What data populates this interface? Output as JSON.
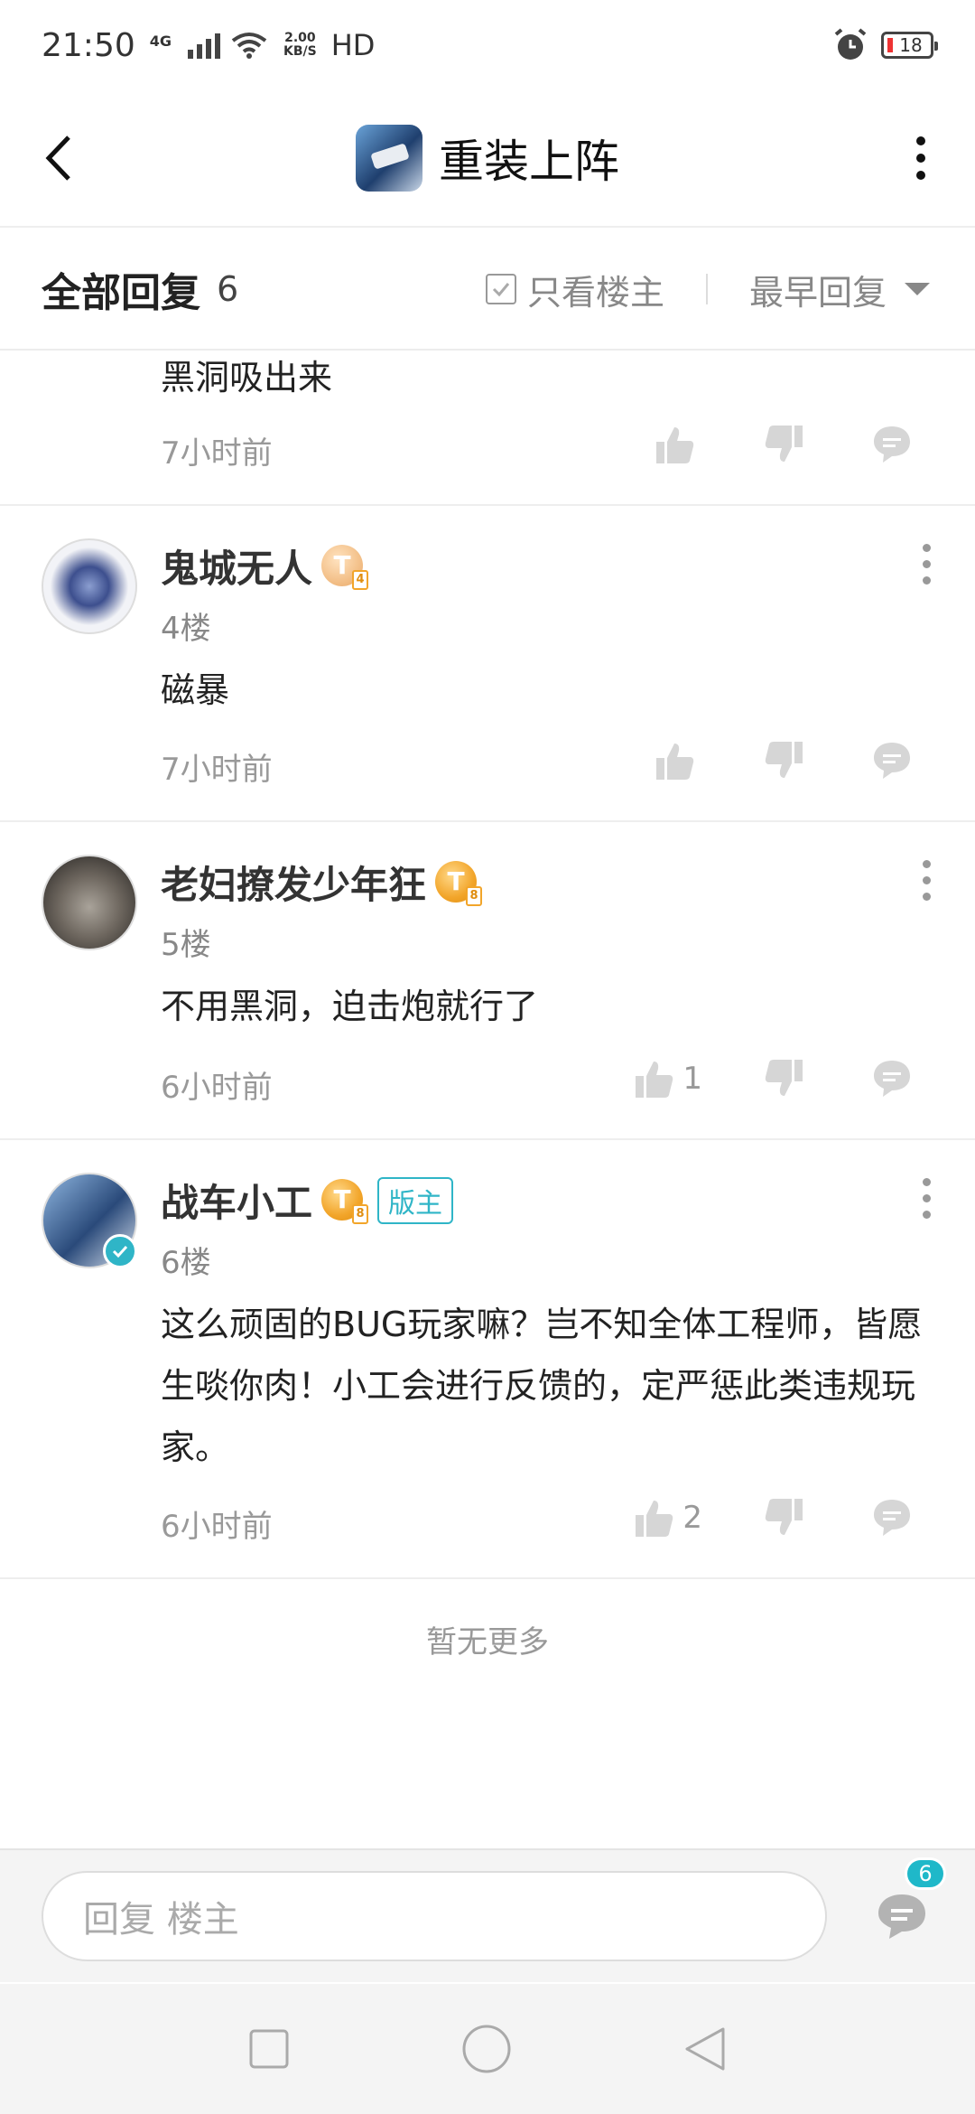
{
  "status_bar": {
    "time": "21:50",
    "network": "4G",
    "net_speed_value": "2.00",
    "net_speed_unit": "KB/S",
    "hd": "HD",
    "battery": "18"
  },
  "header": {
    "title": "重装上阵"
  },
  "filter": {
    "all_replies_label": "全部回复",
    "reply_count": "6",
    "only_op_label": "只看楼主",
    "sort_label": "最早回复"
  },
  "comments": [
    {
      "content": "黑洞吸出来",
      "time": "7小时前"
    },
    {
      "username": "鬼城无人",
      "level": "4",
      "floor": "4楼",
      "content": "磁暴",
      "time": "7小时前"
    },
    {
      "username": "老妇撩发少年狂",
      "level": "8",
      "floor": "5楼",
      "content": "不用黑洞，迫击炮就行了",
      "time": "6小时前",
      "likes": "1"
    },
    {
      "username": "战车小工",
      "level": "8",
      "badge": "版主",
      "floor": "6楼",
      "content": "这么顽固的BUG玩家嘛？岂不知全体工程师，皆愿生啖你肉！小工会进行反馈的，定严惩此类违规玩家。",
      "time": "6小时前",
      "likes": "2"
    }
  ],
  "footer": {
    "no_more": "暂无更多",
    "reply_placeholder": "回复  楼主",
    "message_badge": "6"
  },
  "colors": {
    "accent": "#2fb5c7",
    "badge_gold": "#f2a52a",
    "text_muted": "#999999"
  }
}
